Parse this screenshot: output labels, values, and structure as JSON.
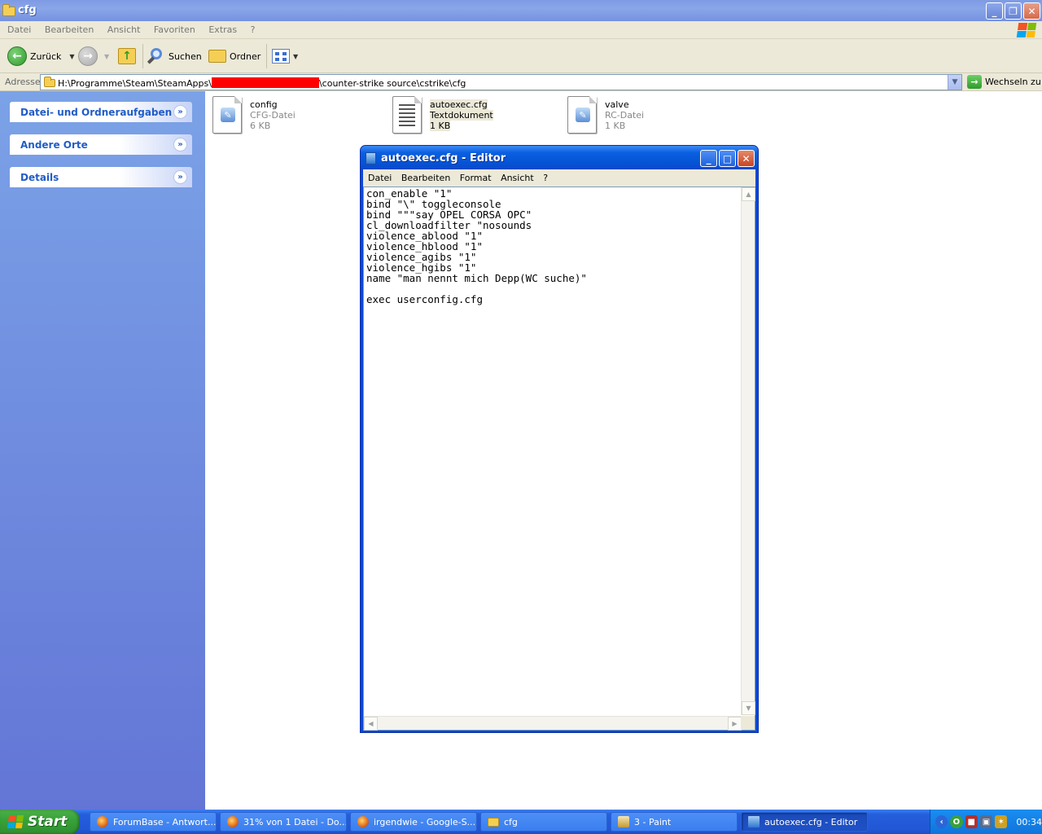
{
  "explorer": {
    "title": "cfg",
    "menu": [
      "Datei",
      "Bearbeiten",
      "Ansicht",
      "Favoriten",
      "Extras",
      "?"
    ],
    "toolbar": {
      "back_label": "Zurück",
      "search_label": "Suchen",
      "folders_label": "Ordner"
    },
    "address": {
      "label": "Adresse",
      "path_before": "H:\\Programme\\Steam\\SteamApps\\",
      "path_after": "\\counter-strike source\\cstrike\\cfg",
      "go_label": "Wechseln zu"
    },
    "taskpane": [
      "Datei- und Ordneraufgaben",
      "Andere Orte",
      "Details"
    ],
    "files": [
      {
        "name": "config",
        "type": "CFG-Datei",
        "size": "6 KB",
        "icon": "cfg-file-icon"
      },
      {
        "name": "autoexec.cfg",
        "type": "Textdokument",
        "size": "1 KB",
        "icon": "text-file-icon"
      },
      {
        "name": "valve",
        "type": "RC-Datei",
        "size": "1 KB",
        "icon": "rc-file-icon"
      }
    ]
  },
  "notepad": {
    "title": "autoexec.cfg - Editor",
    "menu": [
      "Datei",
      "Bearbeiten",
      "Format",
      "Ansicht",
      "?"
    ],
    "content": "con_enable \"1\"\nbind \"\\\" toggleconsole\nbind \"\"\"say OPEL CORSA OPC\"\ncl_downloadfilter \"nosounds\nviolence_ablood \"1\"\nviolence_hblood \"1\"\nviolence_agibs \"1\"\nviolence_hgibs \"1\"\nname \"man nennt mich Depp(WC suche)\"\n\nexec userconfig.cfg"
  },
  "taskbar": {
    "start_label": "Start",
    "tasks": [
      {
        "label": "ForumBase - Antwort...",
        "icon": "firefox-icon"
      },
      {
        "label": "31% von 1 Datei - Do...",
        "icon": "firefox-icon"
      },
      {
        "label": "irgendwie - Google-S...",
        "icon": "firefox-icon"
      },
      {
        "label": "cfg",
        "icon": "folder-icon"
      },
      {
        "label": "3 - Paint",
        "icon": "paint-icon"
      },
      {
        "label": "autoexec.cfg - Editor",
        "icon": "notepad-icon"
      }
    ],
    "clock": "00:34"
  }
}
